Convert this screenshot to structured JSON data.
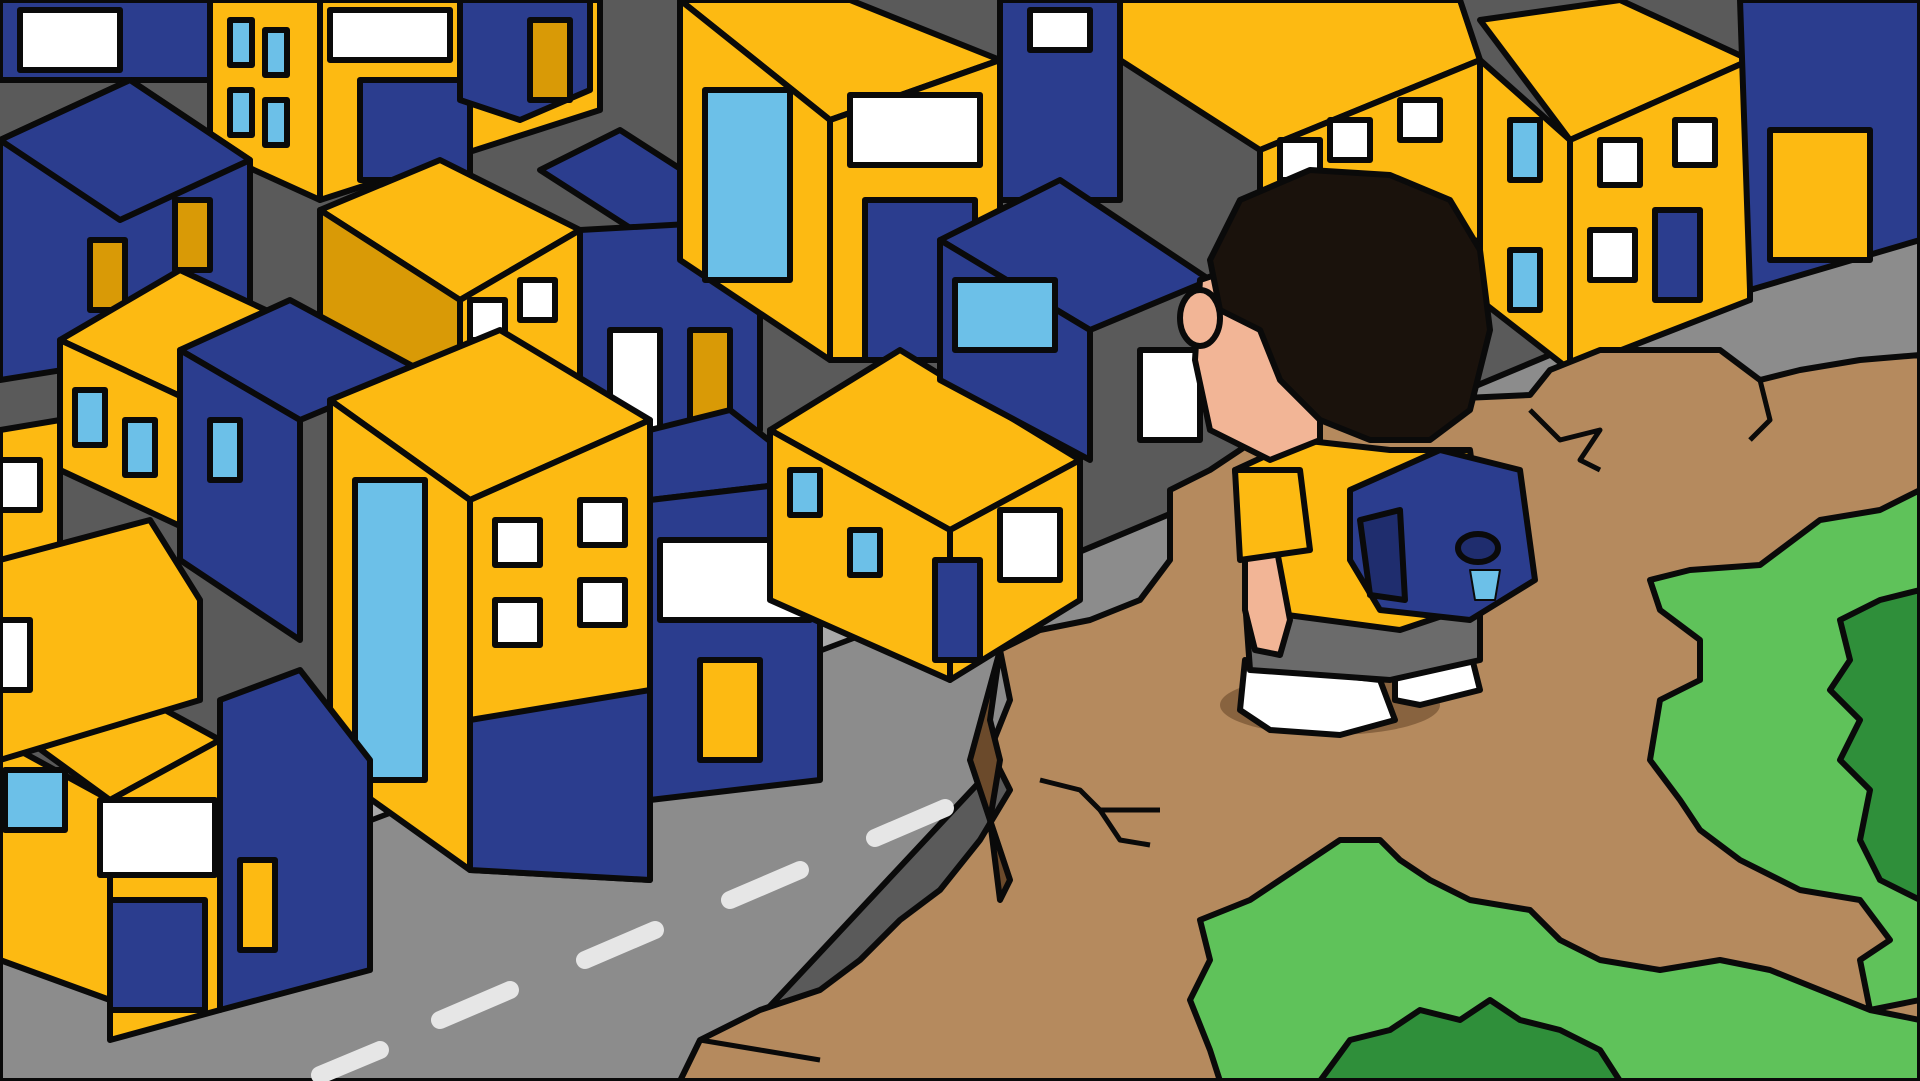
{
  "scene": {
    "description_hidden": "",
    "palette": {
      "building_yellow": "#FDBA12",
      "building_yellow_shade": "#D99A06",
      "building_blue": "#2B3D8E",
      "building_blue_dark": "#1F2D6E",
      "window_white": "#FFFFFF",
      "window_glass": "#6CC0E8",
      "road": "#8C8C8C",
      "road_dark": "#6E6E6E",
      "sidewalk": "#A9A9A9",
      "cliff_dirt": "#B58A5E",
      "grass_light": "#5FC25A",
      "grass_dark": "#2F8F3A",
      "outline": "#0A0A0A",
      "hair": "#1A120C",
      "skin": "#F2B596",
      "shirt": "#FDBA12",
      "shorts": "#6B6B6B",
      "backpack": "#2B3D8E",
      "shoe": "#FFFFFF"
    },
    "icons": [
      "person-figure",
      "backpack-icon",
      "building-icon",
      "road-icon",
      "grass-icon"
    ]
  }
}
